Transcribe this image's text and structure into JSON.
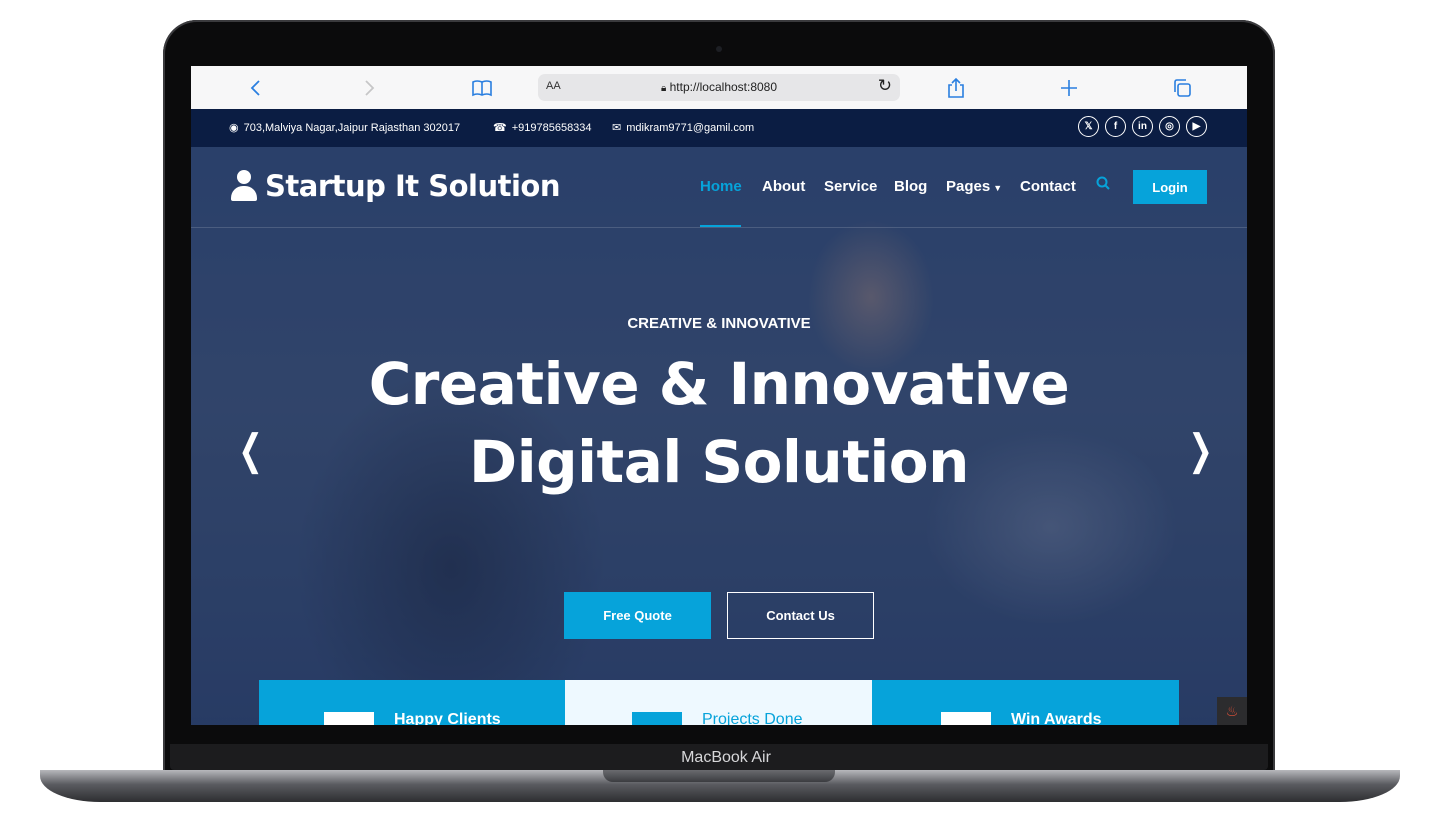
{
  "device": {
    "model_label": "MacBook Air"
  },
  "browser": {
    "aa_label": "AA",
    "url": "http://localhost:8080",
    "icons": [
      "back-icon",
      "forward-icon",
      "bookmarks-icon",
      "lock-icon",
      "reload-icon",
      "share-icon",
      "new-tab-icon",
      "tabs-icon"
    ]
  },
  "topbar": {
    "address": "703,Malviya Nagar,Jaipur Rajasthan 302017",
    "phone": "+919785658334",
    "email": "mdikram9771@gamil.com",
    "social_icons": [
      "twitter-icon",
      "facebook-icon",
      "linkedin-icon",
      "instagram-icon",
      "youtube-icon"
    ]
  },
  "brand": {
    "name": "Startup It Solution"
  },
  "nav": {
    "items": [
      {
        "label": "Home",
        "active": true
      },
      {
        "label": "About"
      },
      {
        "label": "Service"
      },
      {
        "label": "Blog"
      },
      {
        "label": "Pages",
        "dropdown": true
      },
      {
        "label": "Contact"
      }
    ],
    "login_label": "Login"
  },
  "hero": {
    "kicker": "CREATIVE & INNOVATIVE",
    "headline_line1": "Creative & Innovative",
    "headline_line2": "Digital Solution",
    "primary_button": "Free Quote",
    "secondary_button": "Contact Us"
  },
  "stats": [
    {
      "label": "Happy Clients"
    },
    {
      "label": "Projects Done"
    },
    {
      "label": "Win Awards"
    }
  ],
  "colors": {
    "accent": "#06a3da",
    "topbar": "#0b1d43",
    "light_card": "#eef9ff"
  }
}
